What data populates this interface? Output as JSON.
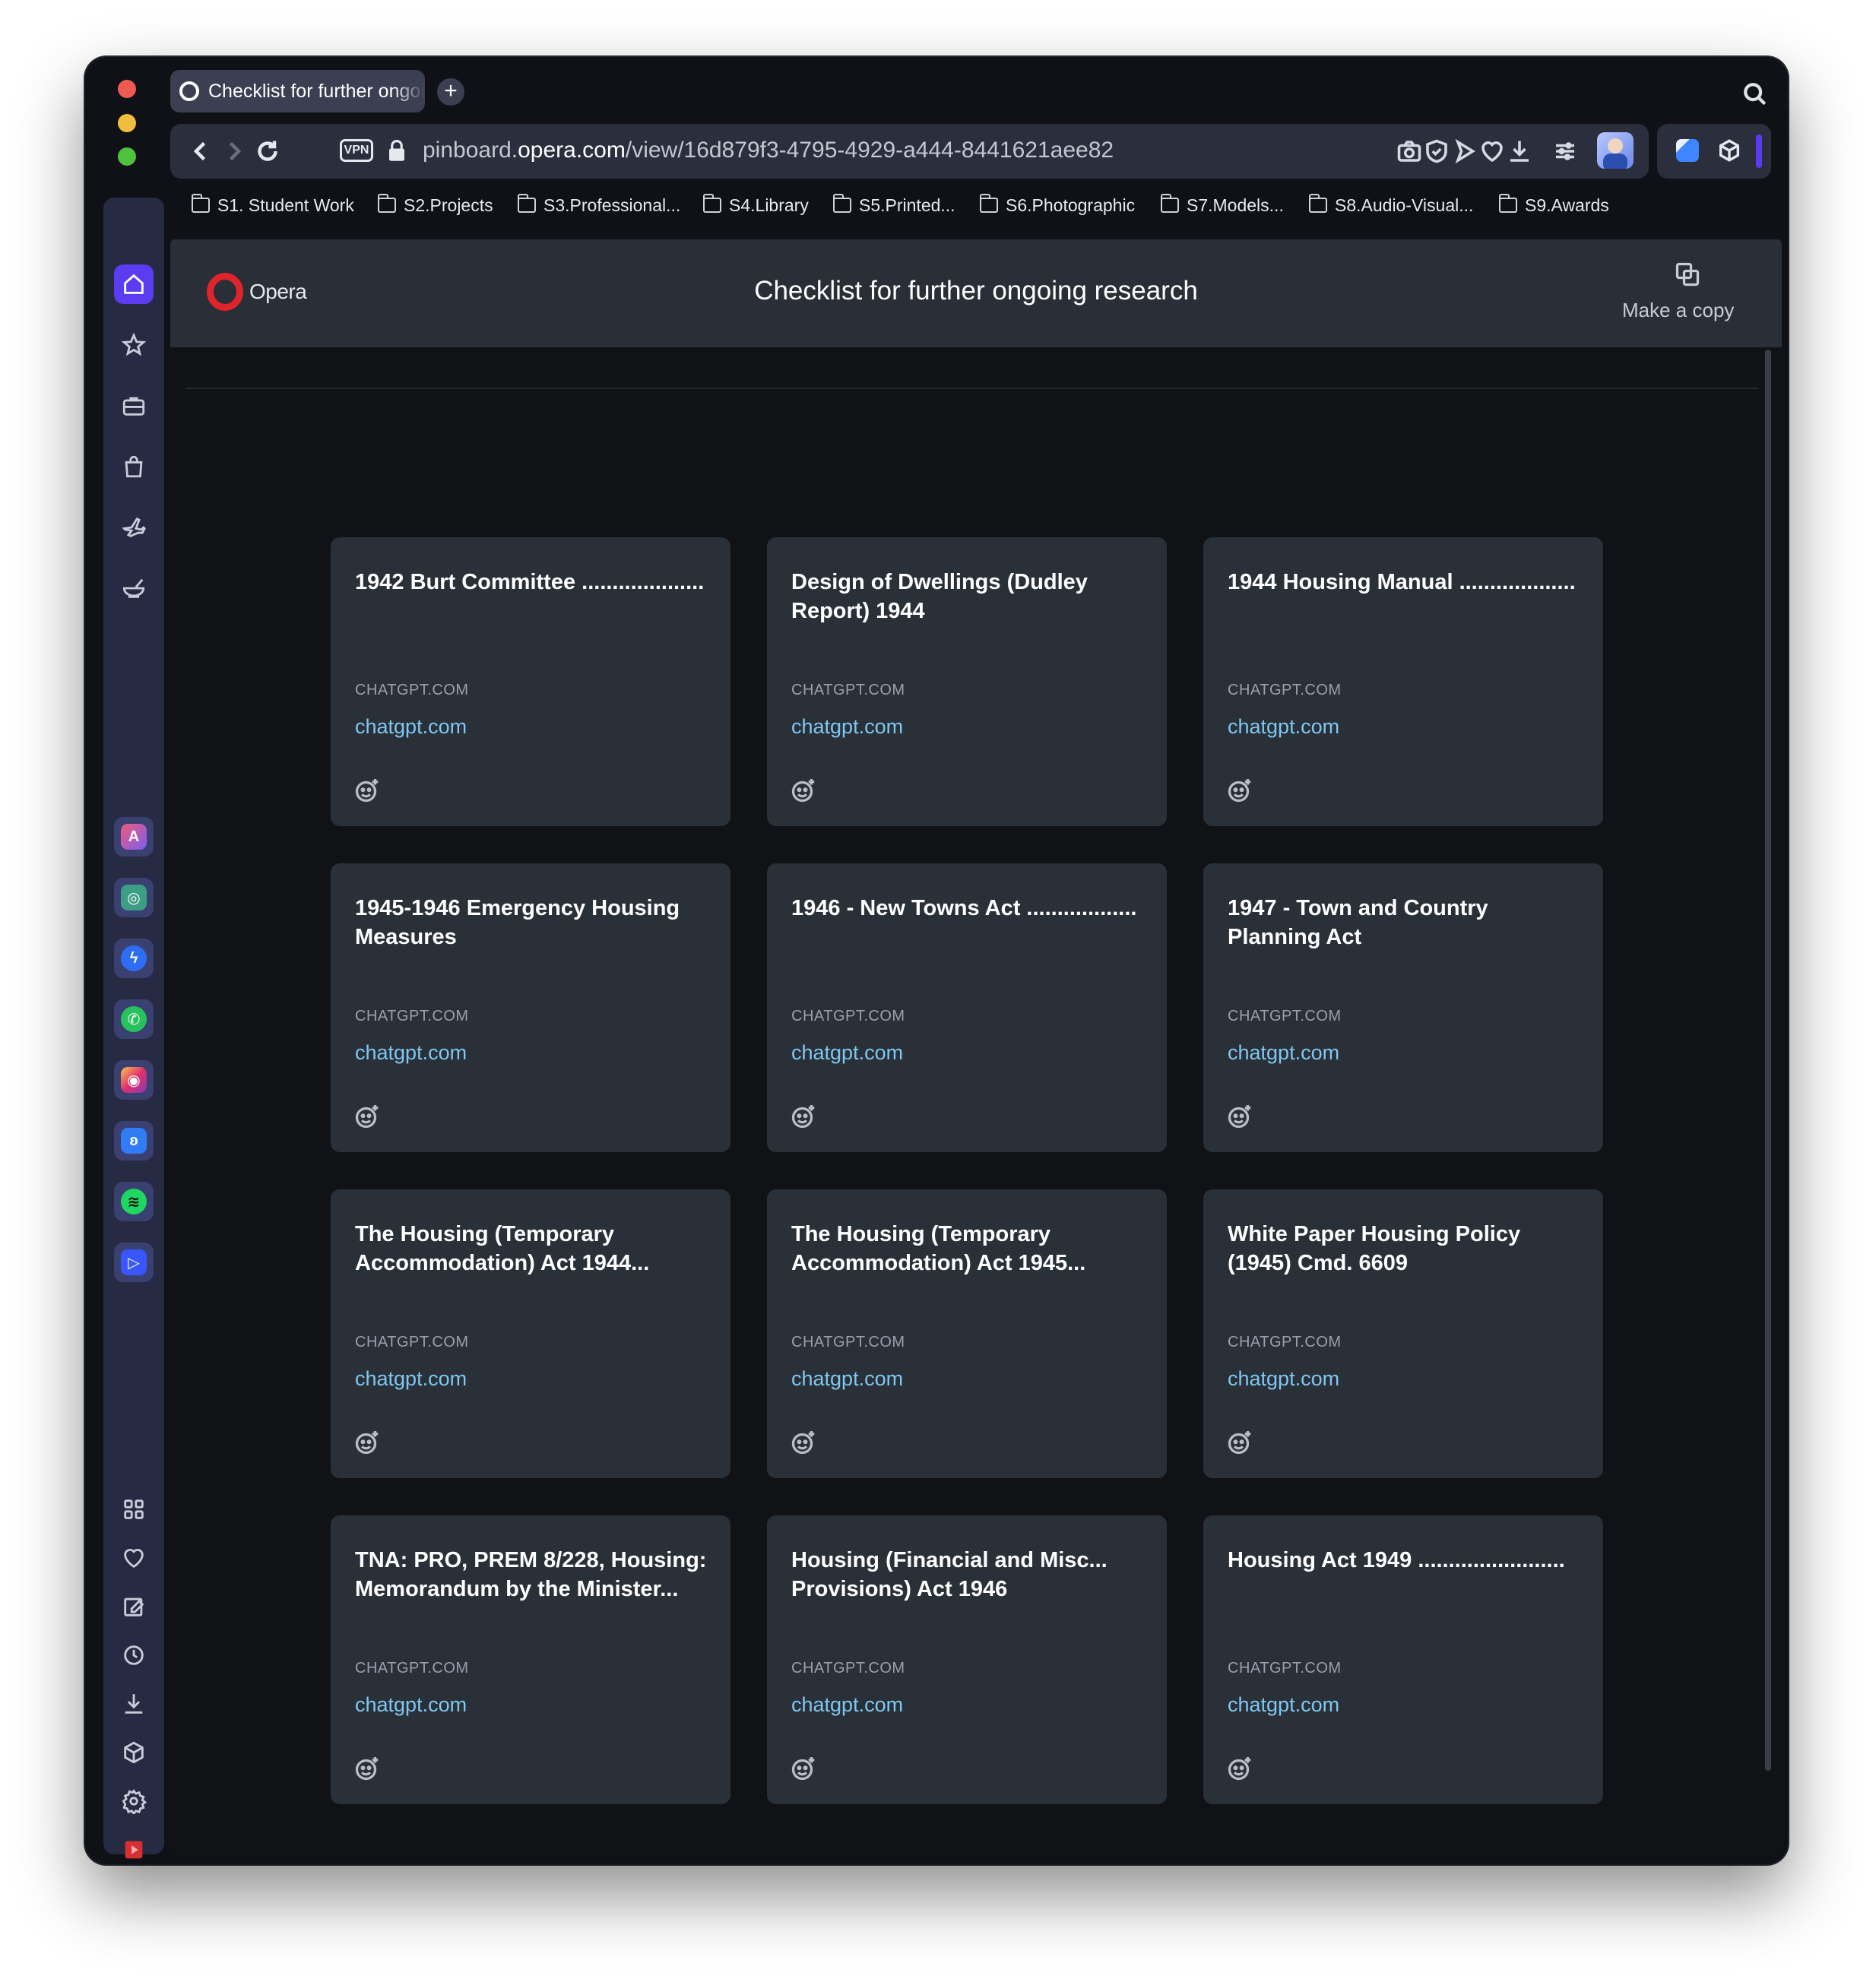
{
  "tab": {
    "title": "Checklist for further ongoing research"
  },
  "address_bar": {
    "vpn_label": "VPN",
    "url_prefix": "pinboard.",
    "url_domain": "opera.com",
    "url_path": "/view/16d879f3-4795-4929-a444-8441621aee82"
  },
  "bookmarks": [
    {
      "label": "S1. Student Work"
    },
    {
      "label": "S2.Projects"
    },
    {
      "label": "S3.Professional..."
    },
    {
      "label": "S4.Library"
    },
    {
      "label": "S5.Printed..."
    },
    {
      "label": "S6.Photographic"
    },
    {
      "label": "S7.Models..."
    },
    {
      "label": "S8.Audio-Visual..."
    },
    {
      "label": "S9.Awards"
    }
  ],
  "bookmarks_more": "»",
  "page": {
    "logo_text": "Opera",
    "title": "Checklist for further ongoing research",
    "make_copy_label": "Make a copy"
  },
  "cards": [
    {
      "title": "1942 Burt Committee ....................",
      "source": "CHATGPT.COM",
      "link": "chatgpt.com"
    },
    {
      "title": "Design of Dwellings (Dudley Report) 1944",
      "source": "CHATGPT.COM",
      "link": "chatgpt.com"
    },
    {
      "title": "1944 Housing Manual ...................",
      "source": "CHATGPT.COM",
      "link": "chatgpt.com"
    },
    {
      "title": "1945-1946 Emergency Housing Measures",
      "source": "CHATGPT.COM",
      "link": "chatgpt.com"
    },
    {
      "title": "1946 - New Towns Act ..................",
      "source": "CHATGPT.COM",
      "link": "chatgpt.com"
    },
    {
      "title": "1947 - Town and Country Planning Act",
      "source": "CHATGPT.COM",
      "link": "chatgpt.com"
    },
    {
      "title": "The Housing (Temporary Accommodation) Act 1944...",
      "source": "CHATGPT.COM",
      "link": "chatgpt.com"
    },
    {
      "title": "The Housing (Temporary Accommodation) Act 1945...",
      "source": "CHATGPT.COM",
      "link": "chatgpt.com"
    },
    {
      "title": "White Paper Housing Policy (1945) Cmd. 6609",
      "source": "CHATGPT.COM",
      "link": "chatgpt.com"
    },
    {
      "title": "TNA: PRO, PREM 8/228, Housing: Memorandum by the Minister...",
      "source": "CHATGPT.COM",
      "link": "chatgpt.com"
    },
    {
      "title": "Housing (Financial and Misc... Provisions) Act 1946",
      "source": "CHATGPT.COM",
      "link": "chatgpt.com"
    },
    {
      "title": "Housing Act 1949 ........................",
      "source": "CHATGPT.COM",
      "link": "chatgpt.com"
    }
  ],
  "sidebar_more": "•••",
  "colors": {
    "accent": "#5b3cf0",
    "link": "#7fc7f0",
    "card_bg": "#2a3038",
    "page_bg": "#101216",
    "sidebar_bg": "#262a43",
    "opera_red": "#e0242b"
  }
}
